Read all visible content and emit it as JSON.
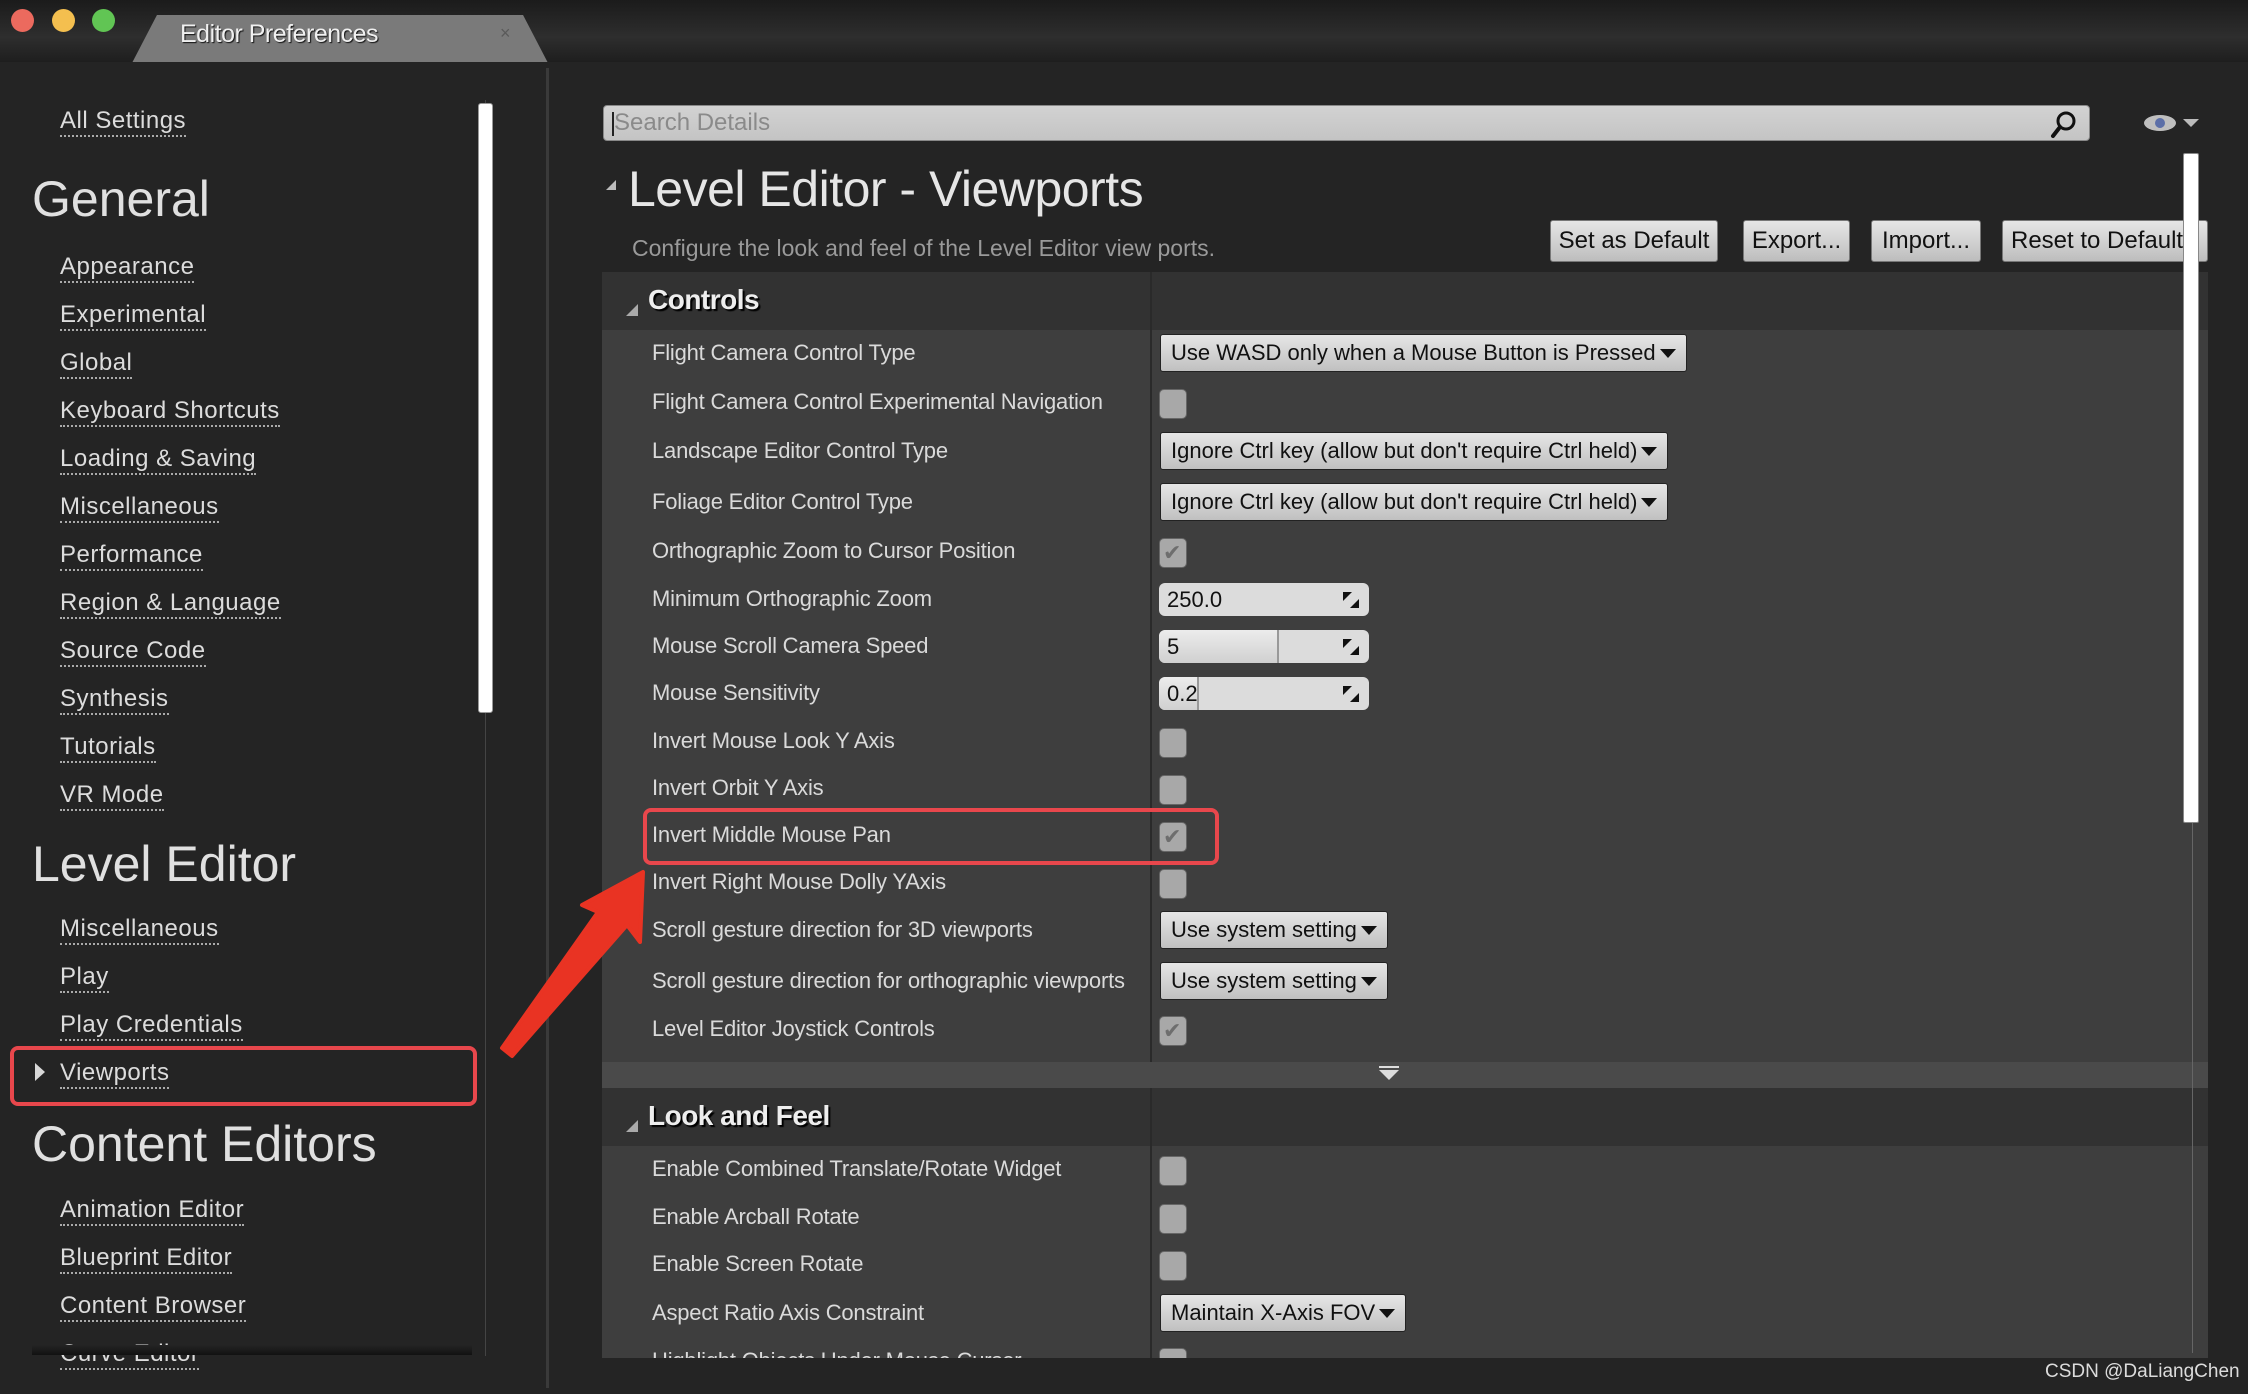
{
  "window": {
    "tab_title": "Editor Preferences",
    "tab_close": "×"
  },
  "sidebar": {
    "all_settings": "All Settings",
    "groups": [
      {
        "heading": "General",
        "items": [
          "Appearance",
          "Experimental",
          "Global",
          "Keyboard Shortcuts",
          "Loading & Saving",
          "Miscellaneous",
          "Performance",
          "Region & Language",
          "Source Code",
          "Synthesis",
          "Tutorials",
          "VR Mode"
        ]
      },
      {
        "heading": "Level Editor",
        "items": [
          "Miscellaneous",
          "Play",
          "Play Credentials",
          "Viewports"
        ]
      },
      {
        "heading": "Content Editors",
        "items": [
          "Animation Editor",
          "Blueprint Editor",
          "Content Browser",
          "Curve Editor"
        ]
      }
    ],
    "selected_item": "Viewports"
  },
  "search": {
    "placeholder": "Search Details",
    "value": ""
  },
  "page": {
    "title": "Level Editor - Viewports",
    "subtitle": "Configure the look and feel of the Level Editor view ports.",
    "buttons": {
      "set_default": "Set as Default",
      "export": "Export...",
      "import": "Import...",
      "reset": "Reset to Defaults"
    }
  },
  "sections": {
    "controls": {
      "title": "Controls",
      "rows": [
        {
          "label": "Flight Camera Control Type",
          "type": "dropdown",
          "value": "Use WASD only when a Mouse Button is Pressed"
        },
        {
          "label": "Flight Camera Control Experimental Navigation",
          "type": "checkbox",
          "checked": false
        },
        {
          "label": "Landscape Editor Control Type",
          "type": "dropdown",
          "value": "Ignore Ctrl key (allow but don't require Ctrl held)"
        },
        {
          "label": "Foliage Editor Control Type",
          "type": "dropdown",
          "value": "Ignore Ctrl key (allow but don't require Ctrl held)"
        },
        {
          "label": "Orthographic Zoom to Cursor Position",
          "type": "checkbox",
          "checked": true
        },
        {
          "label": "Minimum Orthographic Zoom",
          "type": "number",
          "value": "250.0",
          "fill_fraction": 0
        },
        {
          "label": "Mouse Scroll Camera Speed",
          "type": "slider",
          "value": "5",
          "fill_fraction": 0.57
        },
        {
          "label": "Mouse Sensitivity",
          "type": "slider",
          "value": "0.2",
          "fill_fraction": 0.19
        },
        {
          "label": "Invert Mouse Look Y Axis",
          "type": "checkbox",
          "checked": false
        },
        {
          "label": "Invert Orbit Y Axis",
          "type": "checkbox",
          "checked": false
        },
        {
          "label": "Invert Middle Mouse Pan",
          "type": "checkbox",
          "checked": true,
          "highlighted": true
        },
        {
          "label": "Invert Right Mouse Dolly YAxis",
          "type": "checkbox",
          "checked": false
        },
        {
          "label": "Scroll gesture direction for 3D viewports",
          "type": "dropdown",
          "value": "Use system setting"
        },
        {
          "label": "Scroll gesture direction for orthographic viewports",
          "type": "dropdown",
          "value": "Use system setting"
        },
        {
          "label": "Level Editor Joystick Controls",
          "type": "checkbox",
          "checked": true
        }
      ]
    },
    "look_and_feel": {
      "title": "Look and Feel",
      "rows": [
        {
          "label": "Enable Combined Translate/Rotate Widget",
          "type": "checkbox",
          "checked": false
        },
        {
          "label": "Enable Arcball Rotate",
          "type": "checkbox",
          "checked": false
        },
        {
          "label": "Enable Screen Rotate",
          "type": "checkbox",
          "checked": false
        },
        {
          "label": "Aspect Ratio Axis Constraint",
          "type": "dropdown",
          "value": "Maintain X-Axis FOV"
        },
        {
          "label": "Highlight Objects Under Mouse Cursor",
          "type": "checkbox",
          "checked": false
        }
      ]
    }
  },
  "icons": {
    "check": "✔"
  },
  "colors": {
    "highlight": "#e8474c",
    "annotation_arrow": "#e93323"
  },
  "watermark": "CSDN @DaLiangChen"
}
